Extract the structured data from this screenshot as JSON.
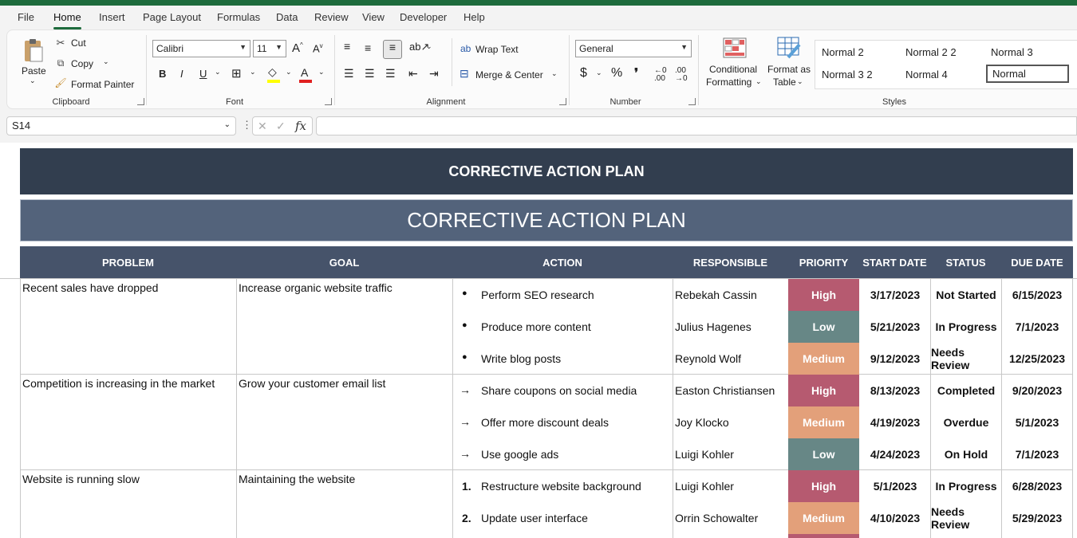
{
  "menu": [
    "File",
    "Home",
    "Insert",
    "Page Layout",
    "Formulas",
    "Data",
    "Review",
    "View",
    "Developer",
    "Help"
  ],
  "ribbon": {
    "clipboard": {
      "paste": "Paste",
      "cut": "Cut",
      "copy": "Copy",
      "format_painter": "Format Painter",
      "label": "Clipboard"
    },
    "font": {
      "family": "Calibri",
      "size": "11",
      "label": "Font"
    },
    "alignment": {
      "wrap": "Wrap Text",
      "merge": "Merge & Center",
      "label": "Alignment"
    },
    "number": {
      "format": "General",
      "label": "Number"
    },
    "styles": {
      "conditional": [
        "Conditional",
        "Formatting"
      ],
      "format_table": [
        "Format as",
        "Table"
      ],
      "cells": [
        "Normal 2",
        "Normal 2 2",
        "Normal 3",
        "Normal 3 2",
        "Normal 4",
        "Normal"
      ],
      "label": "Styles"
    }
  },
  "formula_bar": {
    "name_box": "S14",
    "fx": "fx",
    "value": ""
  },
  "sheet": {
    "title": "CORRECTIVE ACTION PLAN",
    "subtitle": "CORRECTIVE ACTION PLAN",
    "headers": [
      "PROBLEM",
      "GOAL",
      "ACTION",
      "RESPONSIBLE",
      "PRIORITY",
      "START DATE",
      "STATUS",
      "DUE DATE"
    ],
    "groups": [
      {
        "problem": "Recent sales have dropped",
        "goal": "Increase organic website traffic"
      },
      {
        "problem": "Competition is increasing in the market",
        "goal": "Grow your customer email list"
      },
      {
        "problem": "Website is running slow",
        "goal": "Maintaining the website"
      }
    ],
    "rows": [
      {
        "marker": "●",
        "action": "Perform SEO research",
        "responsible": "Rebekah Cassin",
        "priority": "High",
        "start": "3/17/2023",
        "status": "Not Started",
        "due": "6/15/2023"
      },
      {
        "marker": "●",
        "action": "Produce more content",
        "responsible": "Julius Hagenes",
        "priority": "Low",
        "start": "5/21/2023",
        "status": "In Progress",
        "due": "7/1/2023"
      },
      {
        "marker": "●",
        "action": "Write blog posts",
        "responsible": "Reynold Wolf",
        "priority": "Medium",
        "start": "9/12/2023",
        "status": "Needs Review",
        "due": "12/25/2023"
      },
      {
        "marker": "→",
        "action": "Share coupons on social media",
        "responsible": "Easton Christiansen",
        "priority": "High",
        "start": "8/13/2023",
        "status": "Completed",
        "due": "9/20/2023"
      },
      {
        "marker": "→",
        "action": "Offer more discount deals",
        "responsible": "Joy Klocko",
        "priority": "Medium",
        "start": "4/19/2023",
        "status": "Overdue",
        "due": "5/1/2023"
      },
      {
        "marker": "→",
        "action": "Use google ads",
        "responsible": "Luigi Kohler",
        "priority": "Low",
        "start": "4/24/2023",
        "status": "On Hold",
        "due": "7/1/2023"
      },
      {
        "marker": "1.",
        "action": "Restructure website background",
        "responsible": "Luigi Kohler",
        "priority": "High",
        "start": "5/1/2023",
        "status": "In Progress",
        "due": "6/28/2023"
      },
      {
        "marker": "2.",
        "action": "Update user interface",
        "responsible": "Orrin Schowalter",
        "priority": "Medium",
        "start": "4/10/2023",
        "status": "Needs Review",
        "due": "5/29/2023"
      }
    ],
    "priority_colors": {
      "High": "#b65a70",
      "Low": "#678786",
      "Medium": "#e3a07a"
    }
  }
}
